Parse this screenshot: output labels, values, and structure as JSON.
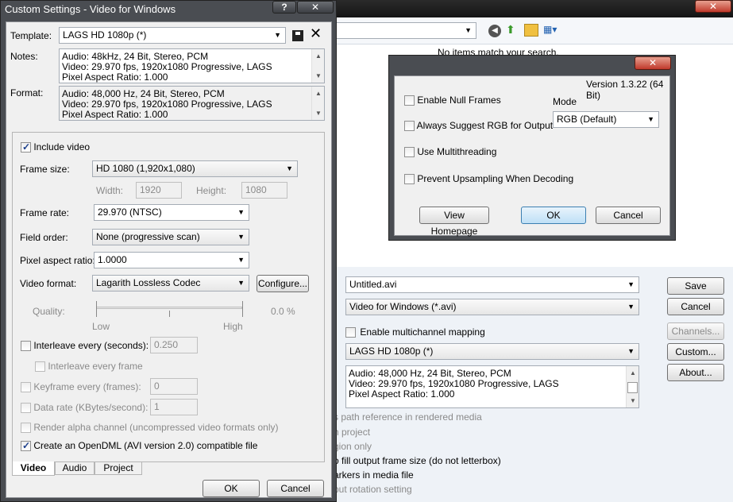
{
  "background_window": {
    "no_items_text": "No items match your search.",
    "filename": "Untitled.avi",
    "save_as_type": "Video for Windows (*.avi)",
    "enable_multichannel": "Enable multichannel mapping",
    "template": "LAGS HD 1080p (*)",
    "description": [
      "Audio: 48,000 Hz, 24 Bit, Stereo, PCM",
      "Video: 29.970 fps, 1920x1080 Progressive, LAGS",
      "Pixel Aspect Ratio: 1.000"
    ],
    "buttons": {
      "save": "Save",
      "cancel": "Cancel",
      "channels": "Channels...",
      "custom": "Custom...",
      "about": "About..."
    },
    "partial_options": [
      "s path reference in rendered media",
      "h project",
      "gion only",
      "o fill output frame size (do not letterbox)",
      "arkers in media file",
      "put rotation setting"
    ]
  },
  "custom_settings": {
    "title": "Custom Settings - Video for Windows",
    "help": "?",
    "close": "✕",
    "template_label": "Template:",
    "template_value": "LAGS HD 1080p (*)",
    "notes_label": "Notes:",
    "notes": [
      "Audio: 48kHz, 24 Bit, Stereo, PCM",
      "Video: 29.970 fps, 1920x1080 Progressive, LAGS",
      "Pixel Aspect Ratio: 1.000"
    ],
    "format_label": "Format:",
    "format": [
      "Audio: 48,000 Hz, 24 Bit, Stereo, PCM",
      "Video: 29.970 fps, 1920x1080 Progressive, LAGS",
      "Pixel Aspect Ratio: 1.000"
    ],
    "include_video": "Include video",
    "frame_size_label": "Frame size:",
    "frame_size": "HD 1080 (1,920x1,080)",
    "width_label": "Width:",
    "width": "1920",
    "height_label": "Height:",
    "height": "1080",
    "frame_rate_label": "Frame rate:",
    "frame_rate": "29.970 (NTSC)",
    "field_order_label": "Field order:",
    "field_order": "None (progressive scan)",
    "par_label": "Pixel aspect ratio:",
    "par": "1.0000",
    "video_format_label": "Video format:",
    "video_format": "Lagarith Lossless Codec",
    "configure": "Configure...",
    "quality_label": "Quality:",
    "quality_value": "0.0 %",
    "low": "Low",
    "high": "High",
    "interleave_label": "Interleave every (seconds):",
    "interleave_value": "0.250",
    "interleave_frame": "Interleave every frame",
    "keyframe_label": "Keyframe every (frames):",
    "keyframe_value": "0",
    "datarate_label": "Data rate (KBytes/second):",
    "datarate_value": "1",
    "render_alpha": "Render alpha channel (uncompressed video formats only)",
    "opendml": "Create an OpenDML (AVI version 2.0) compatible file",
    "tabs": [
      "Video",
      "Audio",
      "Project"
    ],
    "ok": "OK",
    "cancel": "Cancel"
  },
  "lagarith": {
    "close": "✕",
    "version": "Version 1.3.22 (64 Bit)",
    "options": [
      "Enable Null Frames",
      "Always Suggest RGB for Output",
      "Use Multithreading",
      "Prevent Upsampling When Decoding"
    ],
    "mode_label": "Mode",
    "mode_value": "RGB (Default)",
    "view_homepage": "View Homepage",
    "ok": "OK",
    "cancel": "Cancel"
  }
}
